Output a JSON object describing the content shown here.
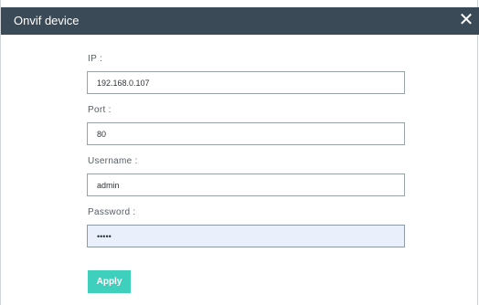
{
  "dialog": {
    "title": "Onvif device",
    "close_glyph": "✕",
    "close_icon": "close-icon"
  },
  "form": {
    "ip": {
      "label": "IP :",
      "value": "192.168.0.107"
    },
    "port": {
      "label": "Port :",
      "value": "80"
    },
    "username": {
      "label": "Username :",
      "value": "admin"
    },
    "password": {
      "label": "Password :",
      "value": "•••••"
    }
  },
  "actions": {
    "apply_label": "Apply"
  },
  "colors": {
    "titlebar": "#3b4a57",
    "accent": "#3fd0bd",
    "focused_field": "#e9f0fb"
  }
}
